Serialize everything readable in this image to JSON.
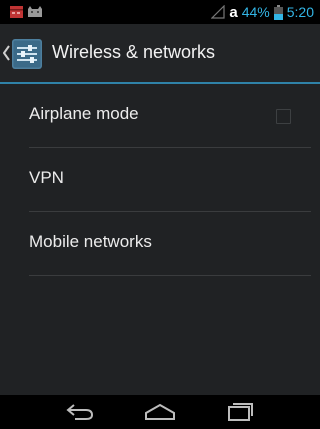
{
  "status_bar": {
    "battery_percent": "44%",
    "time": "5:20",
    "carrier_letter": "a",
    "icons": [
      "notification-calendar-icon",
      "notification-cat-icon",
      "signal-icon",
      "battery-icon"
    ]
  },
  "action_bar": {
    "title": "Wireless & networks",
    "icon": "settings-sliders-icon"
  },
  "preferences": [
    {
      "label": "Airplane mode",
      "type": "checkbox",
      "checked": false
    },
    {
      "label": "VPN",
      "type": "item"
    },
    {
      "label": "Mobile networks",
      "type": "item"
    }
  ],
  "nav_bar": {
    "buttons": [
      "back-icon",
      "home-icon",
      "recents-icon"
    ]
  },
  "colors": {
    "accent": "#33b5e5",
    "background": "#202224",
    "divider": "#3a3c3e"
  }
}
